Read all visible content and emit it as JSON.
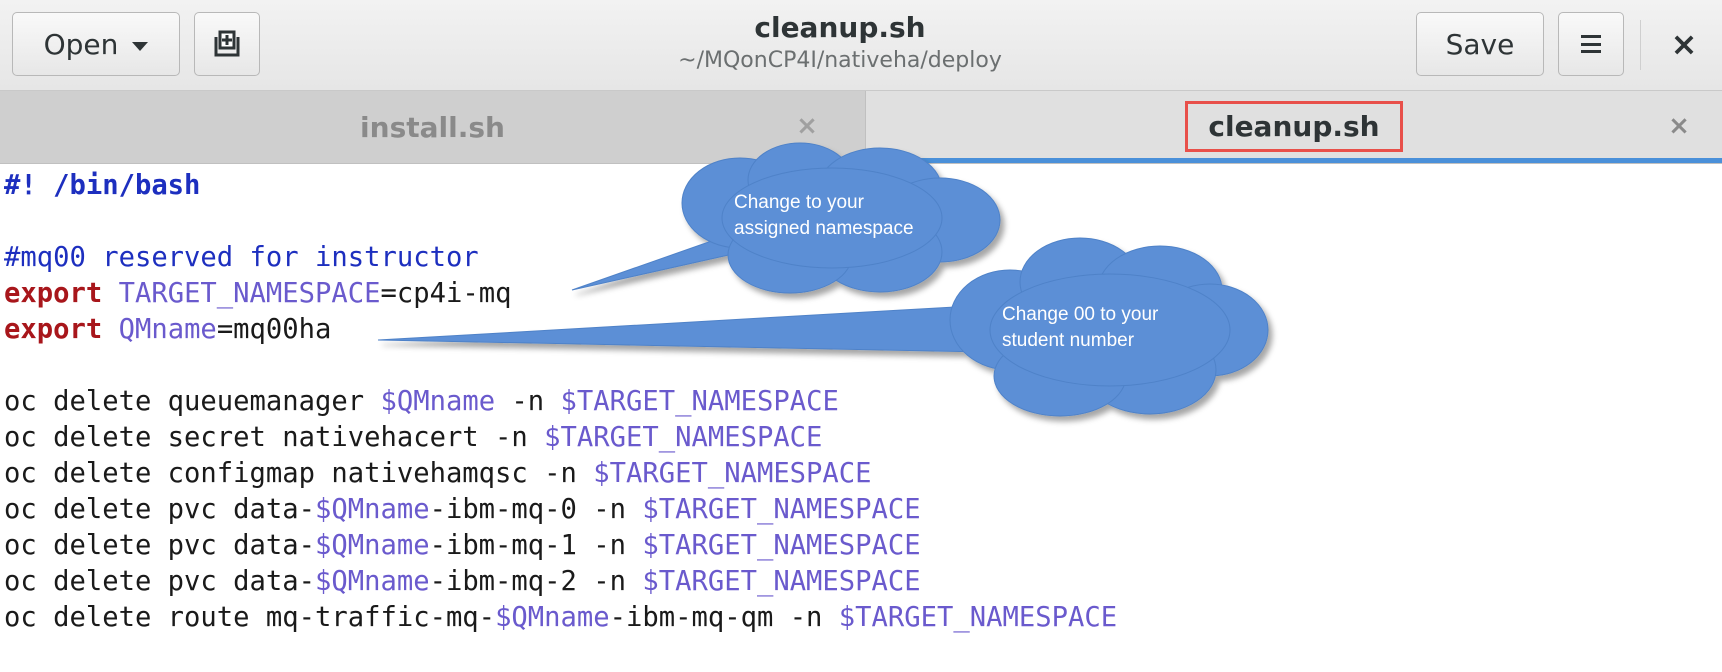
{
  "header": {
    "open_label": "Open",
    "save_label": "Save",
    "title": "cleanup.sh",
    "subtitle": "~/MQonCP4I/nativeha/deploy",
    "close_glyph": "×"
  },
  "tabs": [
    {
      "label": "install.sh",
      "active": false,
      "close_glyph": "×"
    },
    {
      "label": "cleanup.sh",
      "active": true,
      "close_glyph": "×"
    }
  ],
  "editor": {
    "lines": [
      [
        {
          "t": "#! /bin/bash",
          "c": "shebang"
        }
      ],
      [],
      [
        {
          "t": "#mq00 reserved for instructor",
          "c": "comment"
        }
      ],
      [
        {
          "t": "export",
          "c": "kw"
        },
        {
          "t": " "
        },
        {
          "t": "TARGET_NAMESPACE",
          "c": "var"
        },
        {
          "t": "=cp4i-mq"
        }
      ],
      [
        {
          "t": "export",
          "c": "kw"
        },
        {
          "t": " "
        },
        {
          "t": "QMname",
          "c": "var"
        },
        {
          "t": "=mq00ha"
        }
      ],
      [],
      [
        {
          "t": "oc delete queuemanager "
        },
        {
          "t": "$QMname",
          "c": "var"
        },
        {
          "t": " -n "
        },
        {
          "t": "$TARGET_NAMESPACE",
          "c": "var"
        }
      ],
      [
        {
          "t": "oc delete secret nativehacert -n "
        },
        {
          "t": "$TARGET_NAMESPACE",
          "c": "var"
        }
      ],
      [
        {
          "t": "oc delete configmap nativehamqsc -n "
        },
        {
          "t": "$TARGET_NAMESPACE",
          "c": "var"
        }
      ],
      [
        {
          "t": "oc delete pvc data-"
        },
        {
          "t": "$QMname",
          "c": "var"
        },
        {
          "t": "-ibm-mq-0 -n "
        },
        {
          "t": "$TARGET_NAMESPACE",
          "c": "var"
        }
      ],
      [
        {
          "t": "oc delete pvc data-"
        },
        {
          "t": "$QMname",
          "c": "var"
        },
        {
          "t": "-ibm-mq-1 -n "
        },
        {
          "t": "$TARGET_NAMESPACE",
          "c": "var"
        }
      ],
      [
        {
          "t": "oc delete pvc data-"
        },
        {
          "t": "$QMname",
          "c": "var"
        },
        {
          "t": "-ibm-mq-2 -n "
        },
        {
          "t": "$TARGET_NAMESPACE",
          "c": "var"
        }
      ],
      [
        {
          "t": "oc delete route mq-traffic-mq-"
        },
        {
          "t": "$QMname",
          "c": "var"
        },
        {
          "t": "-ibm-mq-qm -n "
        },
        {
          "t": "$TARGET_NAMESPACE",
          "c": "var"
        }
      ]
    ]
  },
  "callouts": [
    {
      "line1": "Change to your",
      "line2": "assigned namespace"
    },
    {
      "line1": "Change 00 to your",
      "line2": "student number"
    }
  ],
  "colors": {
    "accent": "#4a90d9",
    "highlight_box": "#e8504a",
    "cloud_fill": "#5b8fd6",
    "keyword": "#a8161b",
    "variable": "#6a5acd",
    "comment": "#1d2fbf"
  }
}
